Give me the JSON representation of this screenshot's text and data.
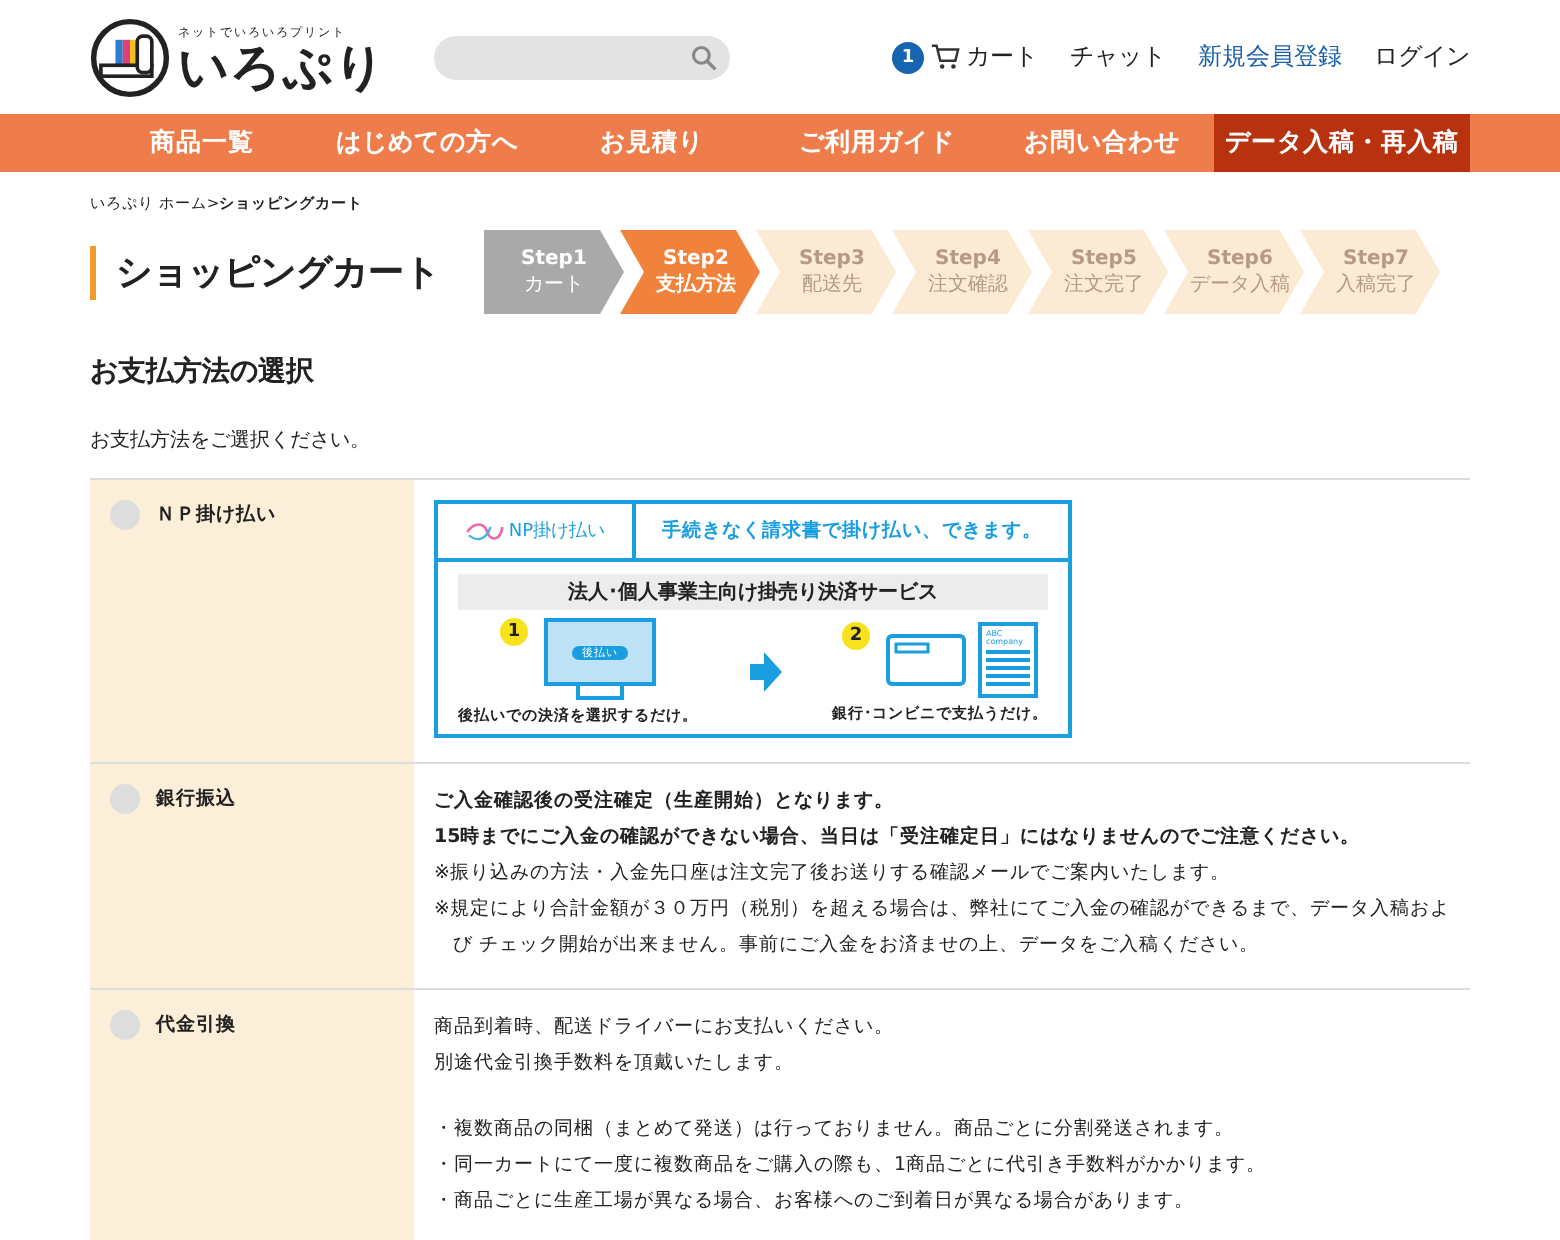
{
  "header": {
    "logo_tagline": "ネットでいろいろプリント",
    "logo_text": "いろぷり",
    "cart_count": "1",
    "links": [
      {
        "label": "カート",
        "kind": "cart"
      },
      {
        "label": "チャット",
        "kind": "plain"
      },
      {
        "label": "新規会員登録",
        "kind": "accent"
      },
      {
        "label": "ログイン",
        "kind": "plain"
      }
    ]
  },
  "nav": [
    {
      "label": "商品一覧",
      "selected": false
    },
    {
      "label": "はじめての方へ",
      "selected": false
    },
    {
      "label": "お見積り",
      "selected": false
    },
    {
      "label": "ご利用ガイド",
      "selected": false
    },
    {
      "label": "お問い合わせ",
      "selected": false
    },
    {
      "label": "データ入稿・再入稿",
      "selected": true
    }
  ],
  "breadcrumb": [
    {
      "label": "いろぷり ホーム",
      "current": false
    },
    {
      "label": "ショッピングカート",
      "current": true
    }
  ],
  "breadcrumb_separator": ">",
  "page_title": "ショッピングカート",
  "steps": [
    {
      "step": "Step1",
      "label": "カート",
      "completed": true,
      "selected": false
    },
    {
      "step": "Step2",
      "label": "支払方法",
      "completed": false,
      "selected": true
    },
    {
      "step": "Step3",
      "label": "配送先",
      "completed": false,
      "selected": false
    },
    {
      "step": "Step4",
      "label": "注文確認",
      "completed": false,
      "selected": false
    },
    {
      "step": "Step5",
      "label": "注文完了",
      "completed": false,
      "selected": false
    },
    {
      "step": "Step6",
      "label": "データ入稿",
      "completed": false,
      "selected": false
    },
    {
      "step": "Step7",
      "label": "入稿完了",
      "completed": false,
      "selected": false
    }
  ],
  "section_title": "お支払方法の選択",
  "intro": "お支払方法をご選択ください。",
  "payment_methods": [
    {
      "name": "ＮＰ掛け払い",
      "selected": false,
      "kind": "np",
      "np_banner": {
        "brand": "NP掛け払い",
        "headline": "手続きなく請求書で掛け払い、できます。",
        "service": "法人･個人事業主向け掛売り決済サービス",
        "steps": [
          {
            "number": "1",
            "screen_label": "後払い",
            "caption": "後払いでの決済を選択するだけ。"
          },
          {
            "number": "2",
            "doc_label": "ABC company",
            "caption": "銀行･コンビニで支払うだけ。"
          }
        ]
      }
    },
    {
      "name": "銀行振込",
      "selected": false,
      "kind": "text",
      "lines": [
        {
          "text": "ご入金確認後の受注確定（生産開始）となります。",
          "kind": "bold"
        },
        {
          "text": "15時までにご入金の確認ができない場合、当日は「受注確定日」にはなりませんのでご注意ください。",
          "kind": "bold"
        },
        {
          "text": "※振り込みの方法・入金先口座は注文完了後お送りする確認メールでご案内いたします。",
          "kind": "note"
        },
        {
          "text": "※規定により合計金額が３０万円（税別）を超える場合は、弊社にてご入金の確認ができるまで、データ入稿および チェック開始が出来ません。事前にご入金をお済ませの上、データをご入稿ください。",
          "kind": "note"
        }
      ]
    },
    {
      "name": "代金引換",
      "selected": false,
      "kind": "text",
      "lines": [
        {
          "text": "商品到着時、配送ドライバーにお支払いください。",
          "kind": "plain"
        },
        {
          "text": "別途代金引換手数料を頂戴いたします。",
          "kind": "plain"
        },
        {
          "text": "・複数商品の同梱（まとめて発送）は行っておりません。商品ごとに分割発送されます。",
          "kind": "gap"
        },
        {
          "text": "・同一カートにて一度に複数商品をご購入の際も、1商品ごとに代引き手数料がかかります。",
          "kind": "plain"
        },
        {
          "text": "・商品ごとに生産工場が異なる場合、お客様へのご到着日が異なる場合があります。",
          "kind": "plain"
        }
      ]
    }
  ]
}
